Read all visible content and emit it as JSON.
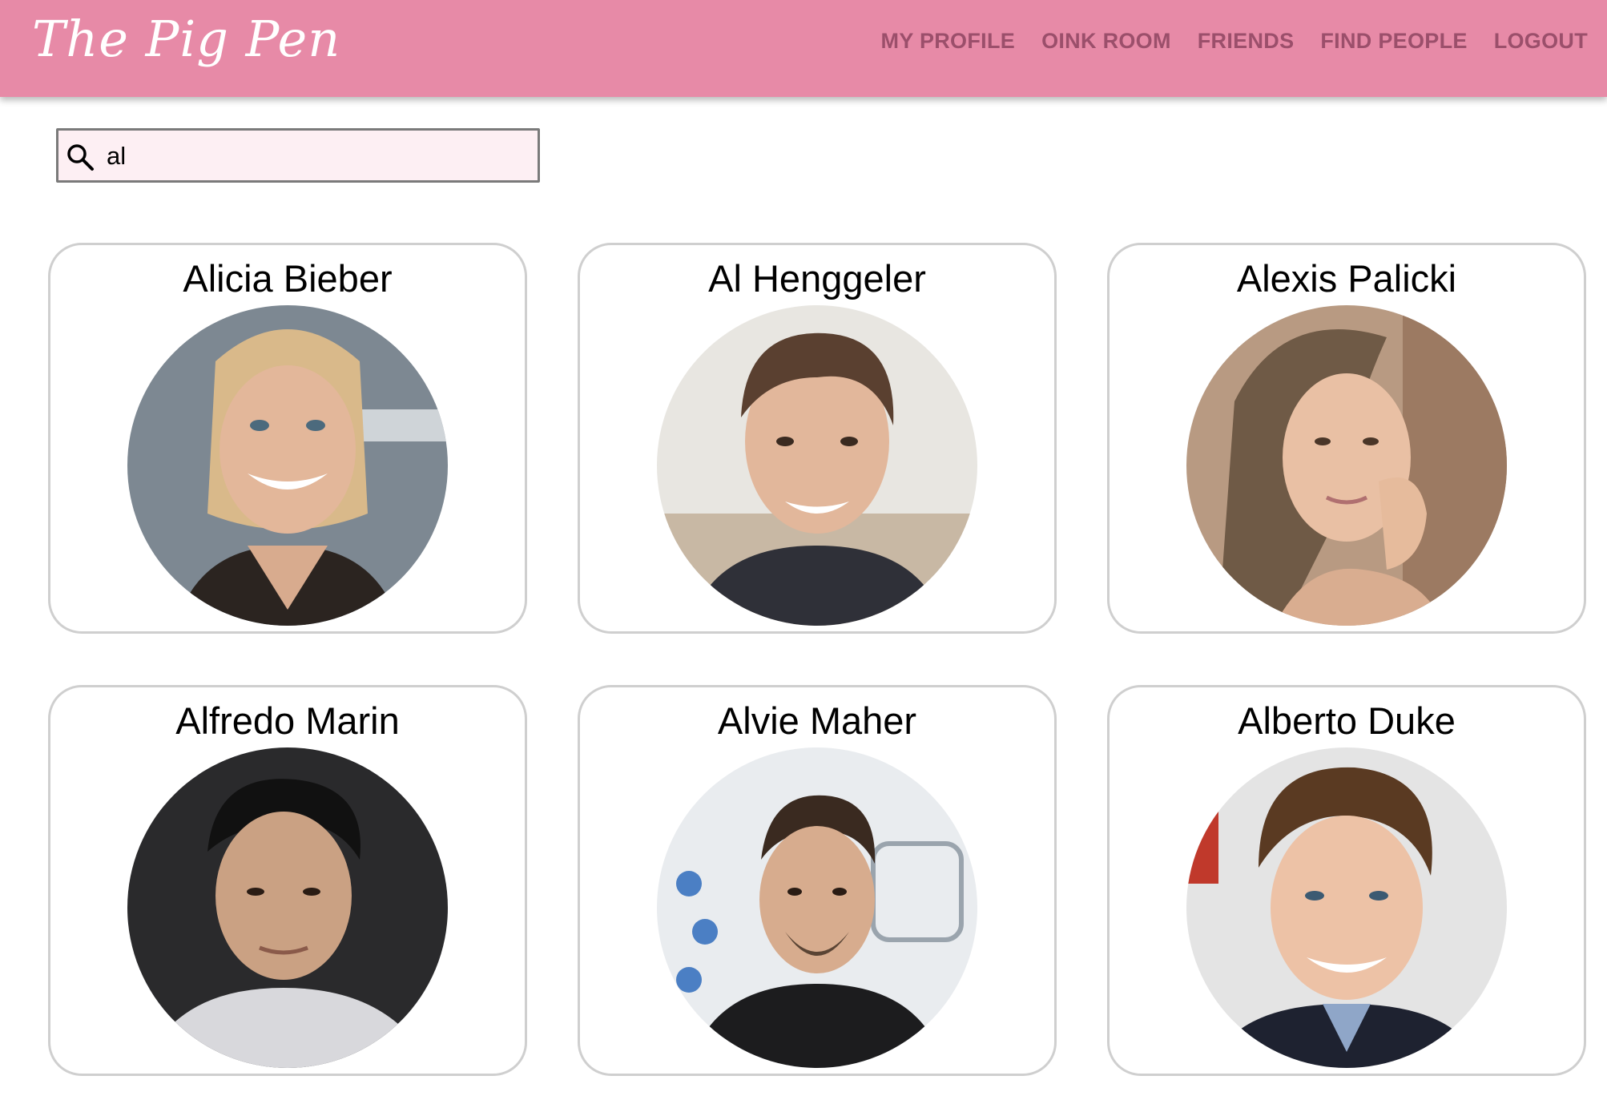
{
  "app": {
    "title": "The Pig Pen",
    "accent_color": "#e78aa7",
    "nav_text_color": "#9b4f6b"
  },
  "nav": {
    "items": [
      {
        "label": "MY PROFILE"
      },
      {
        "label": "OINK ROOM"
      },
      {
        "label": "FRIENDS"
      },
      {
        "label": "FIND PEOPLE"
      },
      {
        "label": "LOGOUT"
      }
    ]
  },
  "search": {
    "value": "al",
    "icon": "search-icon"
  },
  "results": [
    {
      "name": "Alicia Bieber"
    },
    {
      "name": "Al Henggeler"
    },
    {
      "name": "Alexis Palicki"
    },
    {
      "name": "Alfredo Marin"
    },
    {
      "name": "Alvie Maher"
    },
    {
      "name": "Alberto Duke"
    }
  ]
}
